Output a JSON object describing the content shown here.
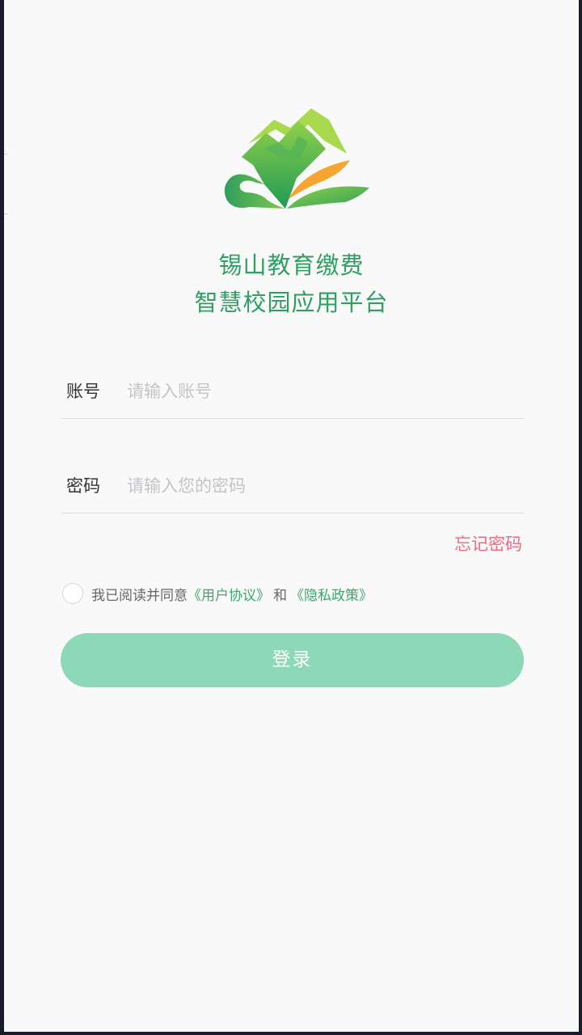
{
  "app": {
    "title_line1": "锡山教育缴费",
    "title_line2": "智慧校园应用平台",
    "logo_icon": "green-mountain-book-logo"
  },
  "form": {
    "account_label": "账号",
    "account_placeholder": "请输入账号",
    "account_value": "",
    "password_label": "密码",
    "password_placeholder": "请输入您的密码",
    "password_value": "",
    "forgot_label": "忘记密码"
  },
  "agreement": {
    "checked": false,
    "prefix": "我已阅读并同意",
    "user_agreement": "《用户协议》",
    "and": "和",
    "privacy_policy": "《隐私政策》"
  },
  "login": {
    "label": "登录"
  },
  "colors": {
    "brand_green": "#2f9e62",
    "link_green": "#3aa66e",
    "button_disabled": "#8dd9b7",
    "forgot_pink": "#ee6b80",
    "background": "#f9f9f9"
  }
}
